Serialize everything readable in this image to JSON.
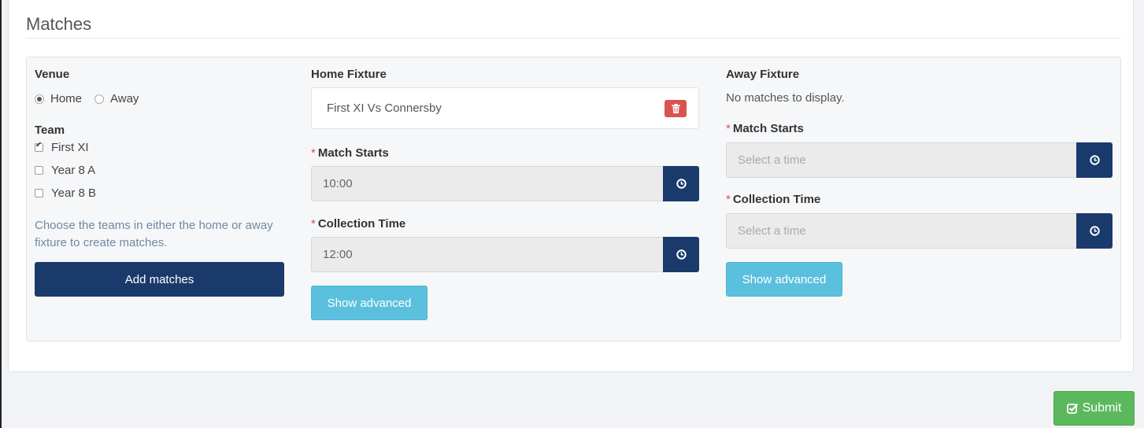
{
  "panel": {
    "title": "Matches"
  },
  "venue": {
    "label": "Venue",
    "options": [
      {
        "label": "Home",
        "selected": true
      },
      {
        "label": "Away",
        "selected": false
      }
    ]
  },
  "team": {
    "label": "Team",
    "items": [
      {
        "label": "First XI",
        "checked": true
      },
      {
        "label": "Year 8 A",
        "checked": false
      },
      {
        "label": "Year 8 B",
        "checked": false
      }
    ]
  },
  "help_text": "Choose the teams in either the home or away fixture to create matches.",
  "add_matches_label": "Add matches",
  "home_fixture": {
    "label": "Home Fixture",
    "fixture": "First XI Vs Connersby",
    "match_starts_label": "Match Starts",
    "match_starts_value": "10:00",
    "collection_time_label": "Collection Time",
    "collection_time_value": "12:00",
    "show_advanced_label": "Show advanced"
  },
  "away_fixture": {
    "label": "Away Fixture",
    "empty_text": "No matches to display.",
    "match_starts_label": "Match Starts",
    "match_starts_placeholder": "Select a time",
    "collection_time_label": "Collection Time",
    "collection_time_placeholder": "Select a time",
    "show_advanced_label": "Show advanced"
  },
  "required_marker": "*",
  "submit_label": "Submit",
  "colors": {
    "primary_dark": "#1a3a6b",
    "info": "#5bc0de",
    "danger": "#d9534f",
    "success": "#5cb85c"
  },
  "icons": {
    "time_addon": "clock-icon",
    "delete": "trash-icon",
    "submit": "check-square-icon"
  }
}
